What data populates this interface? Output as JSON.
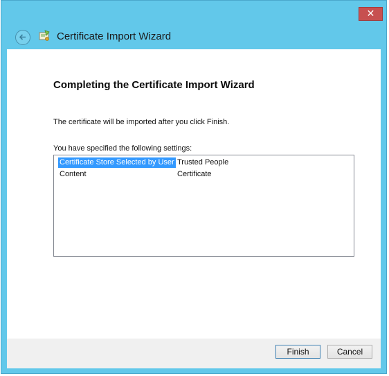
{
  "window": {
    "close_glyph": "✕"
  },
  "header": {
    "title": "Certificate Import Wizard",
    "back_icon": "back-arrow-icon",
    "wizard_icon": "certificate-wizard-icon"
  },
  "content": {
    "heading": "Completing the Certificate Import Wizard",
    "info": "The certificate will be imported after you click Finish.",
    "settings_label": "You have specified the following settings:",
    "settings": [
      {
        "key": "Certificate Store Selected by User",
        "value": "Trusted People",
        "selected": true
      },
      {
        "key": "Content",
        "value": "Certificate",
        "selected": false
      }
    ]
  },
  "footer": {
    "finish_label": "Finish",
    "cancel_label": "Cancel"
  },
  "colors": {
    "title_bar": "#62c8ea",
    "selection": "#3399ff",
    "close_button": "#c75050"
  }
}
